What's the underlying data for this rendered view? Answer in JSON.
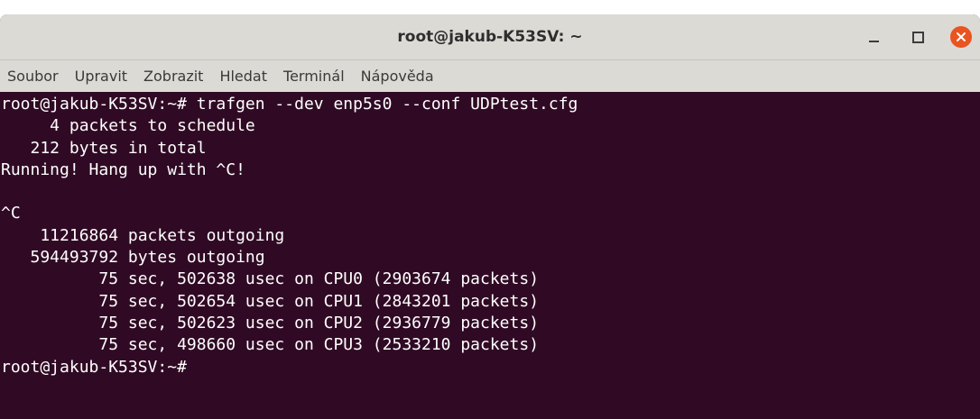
{
  "window": {
    "title": "root@jakub-K53SV: ~"
  },
  "menu": {
    "items": [
      "Soubor",
      "Upravit",
      "Zobrazit",
      "Hledat",
      "Terminál",
      "Nápověda"
    ]
  },
  "terminal": {
    "lines": [
      "root@jakub-K53SV:~# trafgen --dev enp5s0 --conf UDPtest.cfg",
      "     4 packets to schedule",
      "   212 bytes in total",
      "Running! Hang up with ^C!",
      "",
      "^C",
      "    11216864 packets outgoing",
      "   594493792 bytes outgoing",
      "          75 sec, 502638 usec on CPU0 (2903674 packets)",
      "          75 sec, 502654 usec on CPU1 (2843201 packets)",
      "          75 sec, 502623 usec on CPU2 (2936779 packets)",
      "          75 sec, 498660 usec on CPU3 (2533210 packets)",
      "root@jakub-K53SV:~# "
    ]
  },
  "colors": {
    "terminal_background": "#300a24",
    "terminal_foreground": "#ffffff",
    "titlebar_background": "#dcdad5",
    "close_button": "#e95420"
  },
  "icons": {
    "minimize": "minimize-icon",
    "maximize": "maximize-icon",
    "close": "close-icon"
  }
}
